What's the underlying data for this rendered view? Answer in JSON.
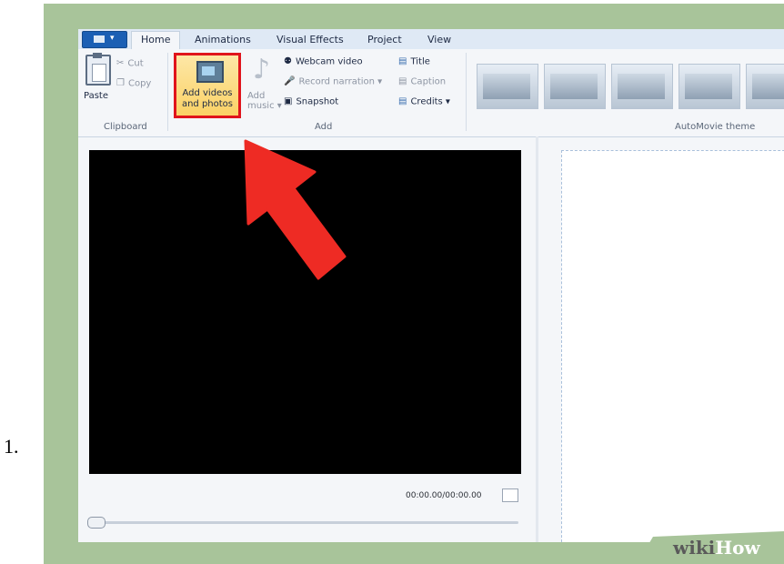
{
  "step": {
    "number": "1."
  },
  "tabs": [
    {
      "label": "Home",
      "active": true
    },
    {
      "label": "Animations"
    },
    {
      "label": "Visual Effects"
    },
    {
      "label": "Project"
    },
    {
      "label": "View"
    }
  ],
  "clipboard": {
    "paste": "Paste",
    "cut": "Cut",
    "copy": "Copy",
    "group_label": "Clipboard"
  },
  "add_group": {
    "add_videos_line1": "Add videos",
    "add_videos_line2": "and photos",
    "add_music_line1": "Add",
    "add_music_line2": "music",
    "webcam": "Webcam video",
    "record": "Record narration",
    "snapshot": "Snapshot",
    "title": "Title",
    "caption": "Caption",
    "credits": "Credits",
    "group_label": "Add"
  },
  "themes": {
    "group_label": "AutoMovie theme"
  },
  "preview": {
    "timecode": "00:00.00/00:00.00"
  },
  "watermark": {
    "wiki": "wiki",
    "how": "How"
  },
  "colors": {
    "highlight_border": "#e0141c",
    "arrow": "#ee2b24",
    "frame": "#a8c49a",
    "accent": "#1b5fb4"
  }
}
